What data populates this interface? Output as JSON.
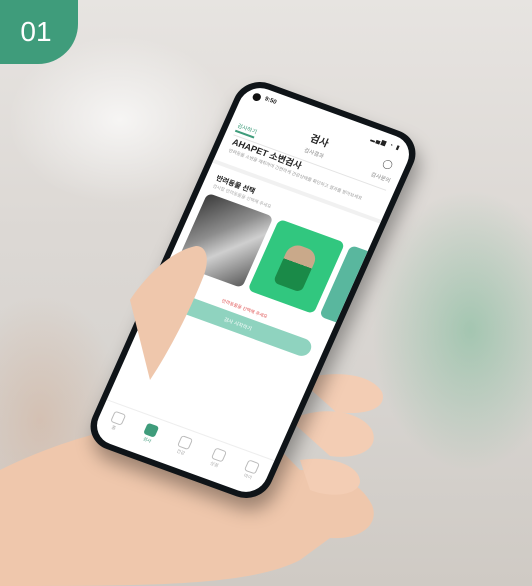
{
  "badge": {
    "label": "01"
  },
  "phone": {
    "status": {
      "time": "9:50",
      "icons": "▂▄▆ ◔ ▮"
    },
    "title": "검사",
    "tabs": [
      "검사하기",
      "검사결과",
      "검사문의"
    ],
    "brand": "AHAPET 소변검사",
    "description": "반려동물 소변을 채취하여 간편하게 건강상태를 확인하고 결과를 받아보세요",
    "section": {
      "title": "반려동물 선택",
      "subtitle": "검사할 반려동물을 선택해 주세요"
    },
    "warning": "반려동물을 선택해 주세요",
    "action_button": "검사 시작하기",
    "nav": [
      "홈",
      "검사",
      "건강",
      "상점",
      "마이"
    ]
  },
  "colors": {
    "accent": "#3f9c7b",
    "button": "#8fd3bf"
  }
}
